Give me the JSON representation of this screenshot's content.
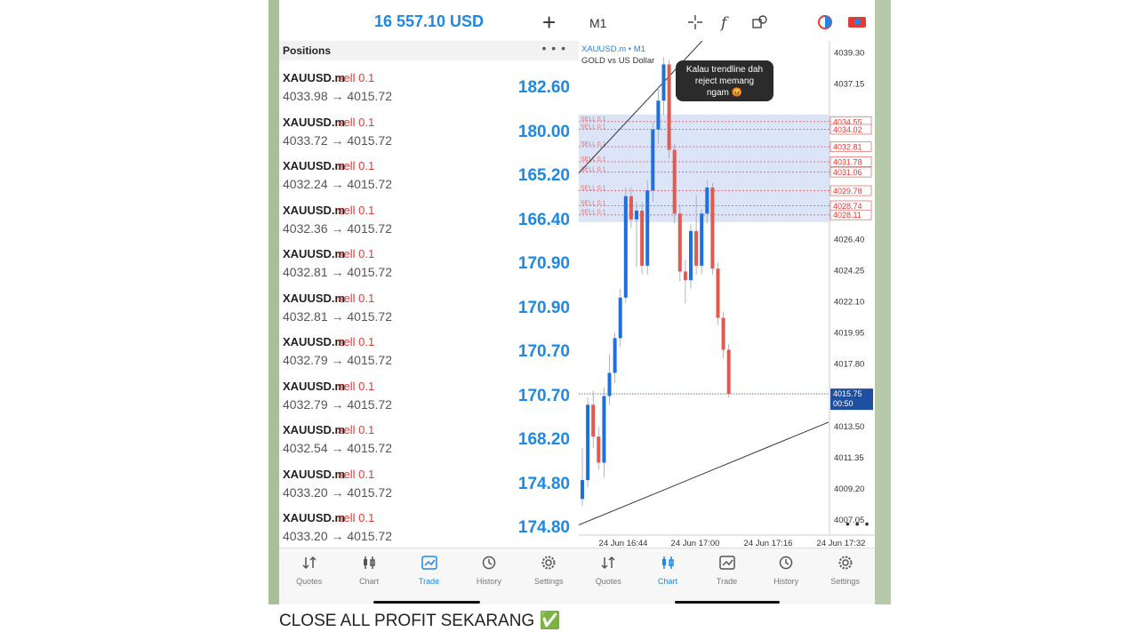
{
  "left": {
    "balance": "16 557.10 USD",
    "add_icon": "plus-icon",
    "positions_title": "Positions",
    "more_icon": "more-icon",
    "positions": [
      {
        "symbol": "XAUUSD.m",
        "side": "sell 0.1",
        "open": "4033.98",
        "current": "4015.72",
        "profit": "182.60"
      },
      {
        "symbol": "XAUUSD.m",
        "side": "sell 0.1",
        "open": "4033.72",
        "current": "4015.72",
        "profit": "180.00"
      },
      {
        "symbol": "XAUUSD.m",
        "side": "sell 0.1",
        "open": "4032.24",
        "current": "4015.72",
        "profit": "165.20"
      },
      {
        "symbol": "XAUUSD.m",
        "side": "sell 0.1",
        "open": "4032.36",
        "current": "4015.72",
        "profit": "166.40"
      },
      {
        "symbol": "XAUUSD.m",
        "side": "sell 0.1",
        "open": "4032.81",
        "current": "4015.72",
        "profit": "170.90"
      },
      {
        "symbol": "XAUUSD.m",
        "side": "sell 0.1",
        "open": "4032.81",
        "current": "4015.72",
        "profit": "170.90"
      },
      {
        "symbol": "XAUUSD.m",
        "side": "sell 0.1",
        "open": "4032.79",
        "current": "4015.72",
        "profit": "170.70"
      },
      {
        "symbol": "XAUUSD.m",
        "side": "sell 0.1",
        "open": "4032.79",
        "current": "4015.72",
        "profit": "170.70"
      },
      {
        "symbol": "XAUUSD.m",
        "side": "sell 0.1",
        "open": "4032.54",
        "current": "4015.72",
        "profit": "168.20"
      },
      {
        "symbol": "XAUUSD.m",
        "side": "sell 0.1",
        "open": "4033.20",
        "current": "4015.72",
        "profit": "174.80"
      },
      {
        "symbol": "XAUUSD.m",
        "side": "sell 0.1",
        "open": "4033.20",
        "current": "4015.72",
        "profit": "174.80"
      }
    ],
    "tabs": [
      {
        "label": "Quotes",
        "icon": "quotes-icon",
        "active": false
      },
      {
        "label": "Chart",
        "icon": "chart-icon",
        "active": false
      },
      {
        "label": "Trade",
        "icon": "trade-icon",
        "active": true
      },
      {
        "label": "History",
        "icon": "history-icon",
        "active": false
      },
      {
        "label": "Settings",
        "icon": "settings-icon",
        "active": false
      }
    ]
  },
  "right": {
    "timeframe": "M1",
    "toolbar_icons": [
      "crosshair-icon",
      "indicator-icon",
      "objects-icon",
      "mode-icon",
      "currency-icon"
    ],
    "chart_data": {
      "type": "candlestick",
      "symbol_label": "XAUUSD.m • M1",
      "description": "GOLD vs US Dollar",
      "annotation": "Kalau trendline dah reject memang ngam 😡",
      "current_price": "4015.75",
      "countdown": "00:50",
      "y_ticks": [
        "4039.30",
        "4037.15",
        "4026.40",
        "4024.25",
        "4022.10",
        "4019.95",
        "4017.80",
        "4013.50",
        "4011.35",
        "4009.20",
        "4007.05"
      ],
      "x_ticks": [
        "24 Jun 16:44",
        "24 Jun 17:00",
        "24 Jun 17:16",
        "24 Jun 17:32"
      ],
      "position_levels": [
        "4034.55",
        "4034.02",
        "4032.81",
        "4031.78",
        "4031.06",
        "4029.78",
        "4028.74",
        "4028.11"
      ],
      "level_label": "SELL 0.1",
      "ylim": [
        4006,
        4040
      ],
      "candles": [
        {
          "o": 4008.5,
          "h": 4012.0,
          "l": 4008.0,
          "c": 4009.8
        },
        {
          "o": 4009.8,
          "h": 4015.5,
          "l": 4009.3,
          "c": 4015.0
        },
        {
          "o": 4015.0,
          "h": 4016.0,
          "l": 4012.0,
          "c": 4012.8
        },
        {
          "o": 4012.8,
          "h": 4013.5,
          "l": 4010.5,
          "c": 4011.0
        },
        {
          "o": 4011.0,
          "h": 4016.2,
          "l": 4010.0,
          "c": 4015.6
        },
        {
          "o": 4015.6,
          "h": 4018.5,
          "l": 4015.0,
          "c": 4017.2
        },
        {
          "o": 4017.2,
          "h": 4020.0,
          "l": 4016.5,
          "c": 4019.6
        },
        {
          "o": 4019.6,
          "h": 4023.0,
          "l": 4019.0,
          "c": 4022.4
        },
        {
          "o": 4022.4,
          "h": 4030.0,
          "l": 4022.0,
          "c": 4029.4
        },
        {
          "o": 4029.4,
          "h": 4030.0,
          "l": 4027.2,
          "c": 4027.8
        },
        {
          "o": 4027.8,
          "h": 4029.0,
          "l": 4024.5,
          "c": 4028.4
        },
        {
          "o": 4028.4,
          "h": 4029.0,
          "l": 4024.0,
          "c": 4024.6
        },
        {
          "o": 4024.6,
          "h": 4030.5,
          "l": 4024.0,
          "c": 4029.8
        },
        {
          "o": 4029.8,
          "h": 4034.5,
          "l": 4029.0,
          "c": 4034.0
        },
        {
          "o": 4034.0,
          "h": 4037.0,
          "l": 4033.0,
          "c": 4036.0
        },
        {
          "o": 4036.0,
          "h": 4039.0,
          "l": 4035.0,
          "c": 4038.5
        },
        {
          "o": 4038.5,
          "h": 4038.8,
          "l": 4032.0,
          "c": 4032.6
        },
        {
          "o": 4032.6,
          "h": 4033.0,
          "l": 4027.5,
          "c": 4028.2
        },
        {
          "o": 4028.2,
          "h": 4028.8,
          "l": 4023.5,
          "c": 4024.2
        },
        {
          "o": 4024.2,
          "h": 4025.0,
          "l": 4022.0,
          "c": 4023.6
        },
        {
          "o": 4023.6,
          "h": 4027.5,
          "l": 4023.0,
          "c": 4027.0
        },
        {
          "o": 4027.0,
          "h": 4029.5,
          "l": 4024.0,
          "c": 4024.6
        },
        {
          "o": 4024.6,
          "h": 4028.5,
          "l": 4024.0,
          "c": 4028.2
        },
        {
          "o": 4028.2,
          "h": 4030.5,
          "l": 4027.5,
          "c": 4030.0
        },
        {
          "o": 4030.0,
          "h": 4030.3,
          "l": 4024.0,
          "c": 4024.4
        },
        {
          "o": 4024.4,
          "h": 4024.8,
          "l": 4020.5,
          "c": 4021.0
        },
        {
          "o": 4021.0,
          "h": 4021.4,
          "l": 4018.2,
          "c": 4018.8
        },
        {
          "o": 4018.8,
          "h": 4019.2,
          "l": 4015.5,
          "c": 4015.75
        }
      ]
    },
    "tabs": [
      {
        "label": "Quotes",
        "icon": "quotes-icon",
        "active": false
      },
      {
        "label": "Chart",
        "icon": "chart-icon",
        "active": true
      },
      {
        "label": "Trade",
        "icon": "trade-icon",
        "active": false
      },
      {
        "label": "History",
        "icon": "history-icon",
        "active": false
      },
      {
        "label": "Settings",
        "icon": "settings-icon",
        "active": false
      }
    ]
  },
  "caption": "CLOSE ALL PROFIT SEKARANG ✅"
}
